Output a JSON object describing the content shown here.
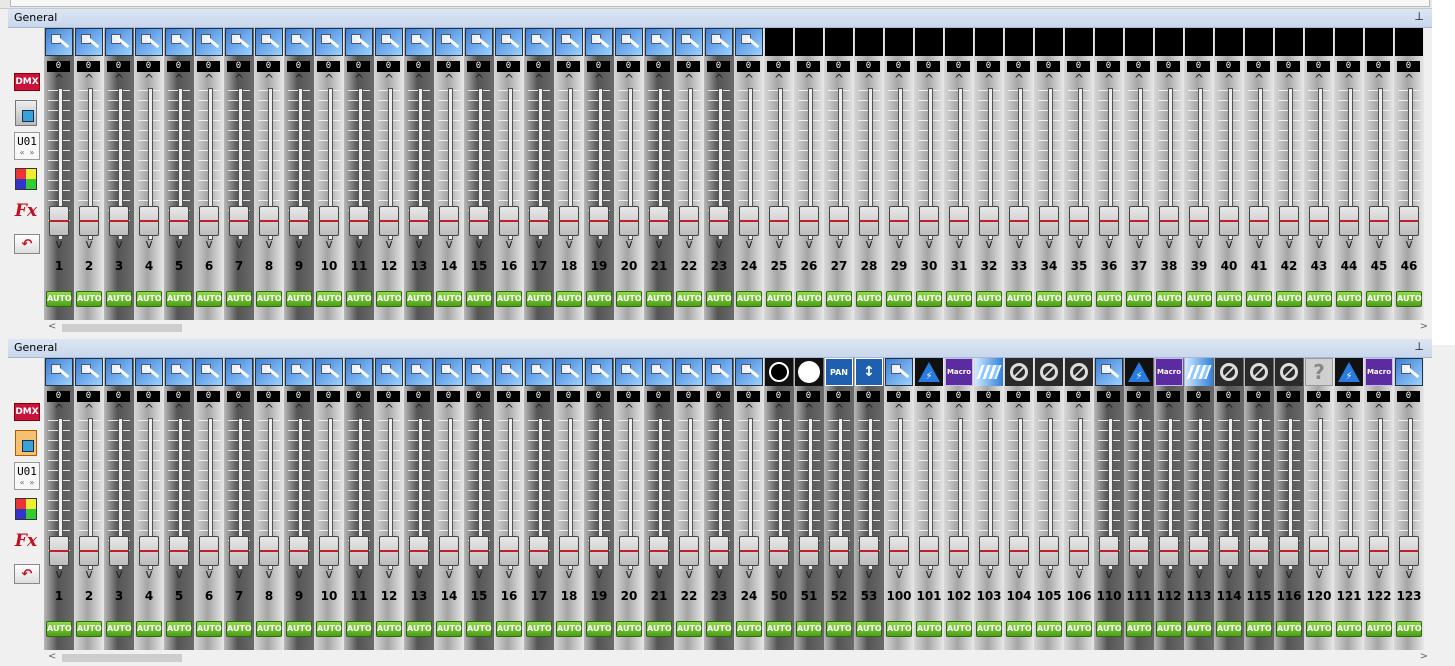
{
  "panels": [
    {
      "title": "General",
      "universe": "U01",
      "dmx_label": "DMX",
      "fx_label": "Fx",
      "fixture_selected": false,
      "channels": [
        {
          "num": "1",
          "value": "0",
          "icon": "dimmer",
          "shade": "dark"
        },
        {
          "num": "2",
          "value": "0",
          "icon": "dimmer",
          "shade": "light"
        },
        {
          "num": "3",
          "value": "0",
          "icon": "dimmer",
          "shade": "dark"
        },
        {
          "num": "4",
          "value": "0",
          "icon": "dimmer",
          "shade": "light"
        },
        {
          "num": "5",
          "value": "0",
          "icon": "dimmer",
          "shade": "dark"
        },
        {
          "num": "6",
          "value": "0",
          "icon": "dimmer",
          "shade": "light"
        },
        {
          "num": "7",
          "value": "0",
          "icon": "dimmer",
          "shade": "dark"
        },
        {
          "num": "8",
          "value": "0",
          "icon": "dimmer",
          "shade": "light"
        },
        {
          "num": "9",
          "value": "0",
          "icon": "dimmer",
          "shade": "dark"
        },
        {
          "num": "10",
          "value": "0",
          "icon": "dimmer",
          "shade": "light"
        },
        {
          "num": "11",
          "value": "0",
          "icon": "dimmer",
          "shade": "dark"
        },
        {
          "num": "12",
          "value": "0",
          "icon": "dimmer",
          "shade": "light"
        },
        {
          "num": "13",
          "value": "0",
          "icon": "dimmer",
          "shade": "dark"
        },
        {
          "num": "14",
          "value": "0",
          "icon": "dimmer",
          "shade": "light"
        },
        {
          "num": "15",
          "value": "0",
          "icon": "dimmer",
          "shade": "dark"
        },
        {
          "num": "16",
          "value": "0",
          "icon": "dimmer",
          "shade": "light"
        },
        {
          "num": "17",
          "value": "0",
          "icon": "dimmer",
          "shade": "dark"
        },
        {
          "num": "18",
          "value": "0",
          "icon": "dimmer",
          "shade": "light"
        },
        {
          "num": "19",
          "value": "0",
          "icon": "dimmer",
          "shade": "dark"
        },
        {
          "num": "20",
          "value": "0",
          "icon": "dimmer",
          "shade": "light"
        },
        {
          "num": "21",
          "value": "0",
          "icon": "dimmer",
          "shade": "dark"
        },
        {
          "num": "22",
          "value": "0",
          "icon": "dimmer",
          "shade": "light"
        },
        {
          "num": "23",
          "value": "0",
          "icon": "dimmer",
          "shade": "dark"
        },
        {
          "num": "24",
          "value": "0",
          "icon": "dimmer",
          "shade": "light"
        },
        {
          "num": "25",
          "value": "0",
          "icon": "empty",
          "shade": "light"
        },
        {
          "num": "26",
          "value": "0",
          "icon": "empty",
          "shade": "light"
        },
        {
          "num": "27",
          "value": "0",
          "icon": "empty",
          "shade": "light"
        },
        {
          "num": "28",
          "value": "0",
          "icon": "empty",
          "shade": "light"
        },
        {
          "num": "29",
          "value": "0",
          "icon": "empty",
          "shade": "light"
        },
        {
          "num": "30",
          "value": "0",
          "icon": "empty",
          "shade": "light"
        },
        {
          "num": "31",
          "value": "0",
          "icon": "empty",
          "shade": "light"
        },
        {
          "num": "32",
          "value": "0",
          "icon": "empty",
          "shade": "light"
        },
        {
          "num": "33",
          "value": "0",
          "icon": "empty",
          "shade": "light"
        },
        {
          "num": "34",
          "value": "0",
          "icon": "empty",
          "shade": "light"
        },
        {
          "num": "35",
          "value": "0",
          "icon": "empty",
          "shade": "light"
        },
        {
          "num": "36",
          "value": "0",
          "icon": "empty",
          "shade": "light"
        },
        {
          "num": "37",
          "value": "0",
          "icon": "empty",
          "shade": "light"
        },
        {
          "num": "38",
          "value": "0",
          "icon": "empty",
          "shade": "light"
        },
        {
          "num": "39",
          "value": "0",
          "icon": "empty",
          "shade": "light"
        },
        {
          "num": "40",
          "value": "0",
          "icon": "empty",
          "shade": "light"
        },
        {
          "num": "41",
          "value": "0",
          "icon": "empty",
          "shade": "light"
        },
        {
          "num": "42",
          "value": "0",
          "icon": "empty",
          "shade": "light"
        },
        {
          "num": "43",
          "value": "0",
          "icon": "empty",
          "shade": "light"
        },
        {
          "num": "44",
          "value": "0",
          "icon": "empty",
          "shade": "light"
        },
        {
          "num": "45",
          "value": "0",
          "icon": "empty",
          "shade": "light"
        },
        {
          "num": "46",
          "value": "0",
          "icon": "empty",
          "shade": "light"
        }
      ]
    },
    {
      "title": "General",
      "universe": "U01",
      "dmx_label": "DMX",
      "fx_label": "Fx",
      "fixture_selected": true,
      "channels": [
        {
          "num": "1",
          "value": "0",
          "icon": "dimmer",
          "shade": "dark"
        },
        {
          "num": "2",
          "value": "0",
          "icon": "dimmer",
          "shade": "light"
        },
        {
          "num": "3",
          "value": "0",
          "icon": "dimmer",
          "shade": "dark"
        },
        {
          "num": "4",
          "value": "0",
          "icon": "dimmer",
          "shade": "light"
        },
        {
          "num": "5",
          "value": "0",
          "icon": "dimmer",
          "shade": "dark"
        },
        {
          "num": "6",
          "value": "0",
          "icon": "dimmer",
          "shade": "light"
        },
        {
          "num": "7",
          "value": "0",
          "icon": "dimmer",
          "shade": "dark"
        },
        {
          "num": "8",
          "value": "0",
          "icon": "dimmer",
          "shade": "light"
        },
        {
          "num": "9",
          "value": "0",
          "icon": "dimmer",
          "shade": "dark"
        },
        {
          "num": "10",
          "value": "0",
          "icon": "dimmer",
          "shade": "light"
        },
        {
          "num": "11",
          "value": "0",
          "icon": "dimmer",
          "shade": "dark"
        },
        {
          "num": "12",
          "value": "0",
          "icon": "dimmer",
          "shade": "light"
        },
        {
          "num": "13",
          "value": "0",
          "icon": "dimmer",
          "shade": "dark"
        },
        {
          "num": "14",
          "value": "0",
          "icon": "dimmer",
          "shade": "light"
        },
        {
          "num": "15",
          "value": "0",
          "icon": "dimmer",
          "shade": "dark"
        },
        {
          "num": "16",
          "value": "0",
          "icon": "dimmer",
          "shade": "light"
        },
        {
          "num": "17",
          "value": "0",
          "icon": "dimmer",
          "shade": "dark"
        },
        {
          "num": "18",
          "value": "0",
          "icon": "dimmer",
          "shade": "light"
        },
        {
          "num": "19",
          "value": "0",
          "icon": "dimmer",
          "shade": "dark"
        },
        {
          "num": "20",
          "value": "0",
          "icon": "dimmer",
          "shade": "light"
        },
        {
          "num": "21",
          "value": "0",
          "icon": "dimmer",
          "shade": "dark"
        },
        {
          "num": "22",
          "value": "0",
          "icon": "dimmer",
          "shade": "light"
        },
        {
          "num": "23",
          "value": "0",
          "icon": "dimmer",
          "shade": "dark"
        },
        {
          "num": "24",
          "value": "0",
          "icon": "dimmer",
          "shade": "light"
        },
        {
          "num": "50",
          "value": "0",
          "icon": "black-circle",
          "shade": "dark"
        },
        {
          "num": "51",
          "value": "0",
          "icon": "white-circle",
          "shade": "dark"
        },
        {
          "num": "52",
          "value": "0",
          "icon": "pan",
          "label": "PAN",
          "shade": "dark"
        },
        {
          "num": "53",
          "value": "0",
          "icon": "tilt",
          "shade": "dark"
        },
        {
          "num": "100",
          "value": "0",
          "icon": "dimmer",
          "shade": "light"
        },
        {
          "num": "101",
          "value": "0",
          "icon": "strobe",
          "shade": "light"
        },
        {
          "num": "102",
          "value": "0",
          "icon": "macro",
          "label": "Macro",
          "shade": "light"
        },
        {
          "num": "103",
          "value": "0",
          "icon": "prism",
          "shade": "light"
        },
        {
          "num": "104",
          "value": "0",
          "icon": "no-function",
          "shade": "light"
        },
        {
          "num": "105",
          "value": "0",
          "icon": "no-function",
          "shade": "light"
        },
        {
          "num": "106",
          "value": "0",
          "icon": "no-function",
          "shade": "light"
        },
        {
          "num": "110",
          "value": "0",
          "icon": "dimmer",
          "shade": "dark"
        },
        {
          "num": "111",
          "value": "0",
          "icon": "strobe",
          "shade": "dark"
        },
        {
          "num": "112",
          "value": "0",
          "icon": "macro",
          "label": "Macro",
          "shade": "dark"
        },
        {
          "num": "113",
          "value": "0",
          "icon": "prism",
          "shade": "dark"
        },
        {
          "num": "114",
          "value": "0",
          "icon": "no-function",
          "shade": "dark"
        },
        {
          "num": "115",
          "value": "0",
          "icon": "no-function",
          "shade": "dark"
        },
        {
          "num": "116",
          "value": "0",
          "icon": "no-function",
          "shade": "dark"
        },
        {
          "num": "120",
          "value": "0",
          "icon": "unknown",
          "label": "?",
          "shade": "light"
        },
        {
          "num": "121",
          "value": "0",
          "icon": "strobe",
          "shade": "light"
        },
        {
          "num": "122",
          "value": "0",
          "icon": "macro",
          "label": "Macro",
          "shade": "light"
        },
        {
          "num": "123",
          "value": "0",
          "icon": "dimmer",
          "shade": "light"
        }
      ]
    }
  ],
  "auto_label": "AUTO",
  "up_arrow": "^",
  "down_arrow": "v",
  "pin_glyph": "⊥",
  "colors": {
    "auto_green": "#6cc22e",
    "dmx_red": "#c8143c",
    "header_blue": "#c9d7ec"
  }
}
